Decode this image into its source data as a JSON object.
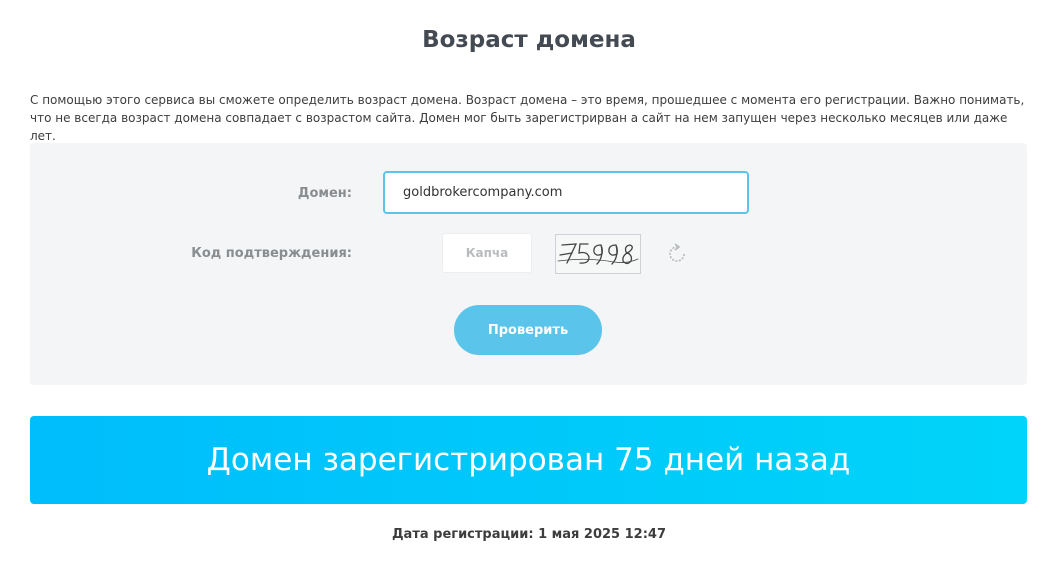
{
  "page": {
    "title": "Возраст домена",
    "description": "С помощью этого сервиса вы сможете определить возраст домена. Возраст домена – это время, прошедшее с момента его регистрации. Важно понимать, что не всегда возраст домена совпадает с возрастом сайта. Домен мог быть зарегистрирван а сайт на нем запущен через несколько месяцев или даже лет."
  },
  "form": {
    "domain_label": "Домен:",
    "domain_value": "goldbrokercompany.com",
    "captcha_label": "Код подтверждения:",
    "captcha_placeholder": "Капча",
    "captcha_image_text": "75998",
    "refresh_icon": "refresh-icon",
    "submit_label": "Проверить"
  },
  "result": {
    "headline": "Домен зарегистрирован 75 дней назад",
    "registration_date": "Дата регистрации: 1 мая 2025 12:47"
  },
  "colors": {
    "accent": "#5bc4ea",
    "banner_start": "#00bdfb",
    "banner_end": "#00d4fa",
    "panel_bg": "#f3f5f6"
  }
}
